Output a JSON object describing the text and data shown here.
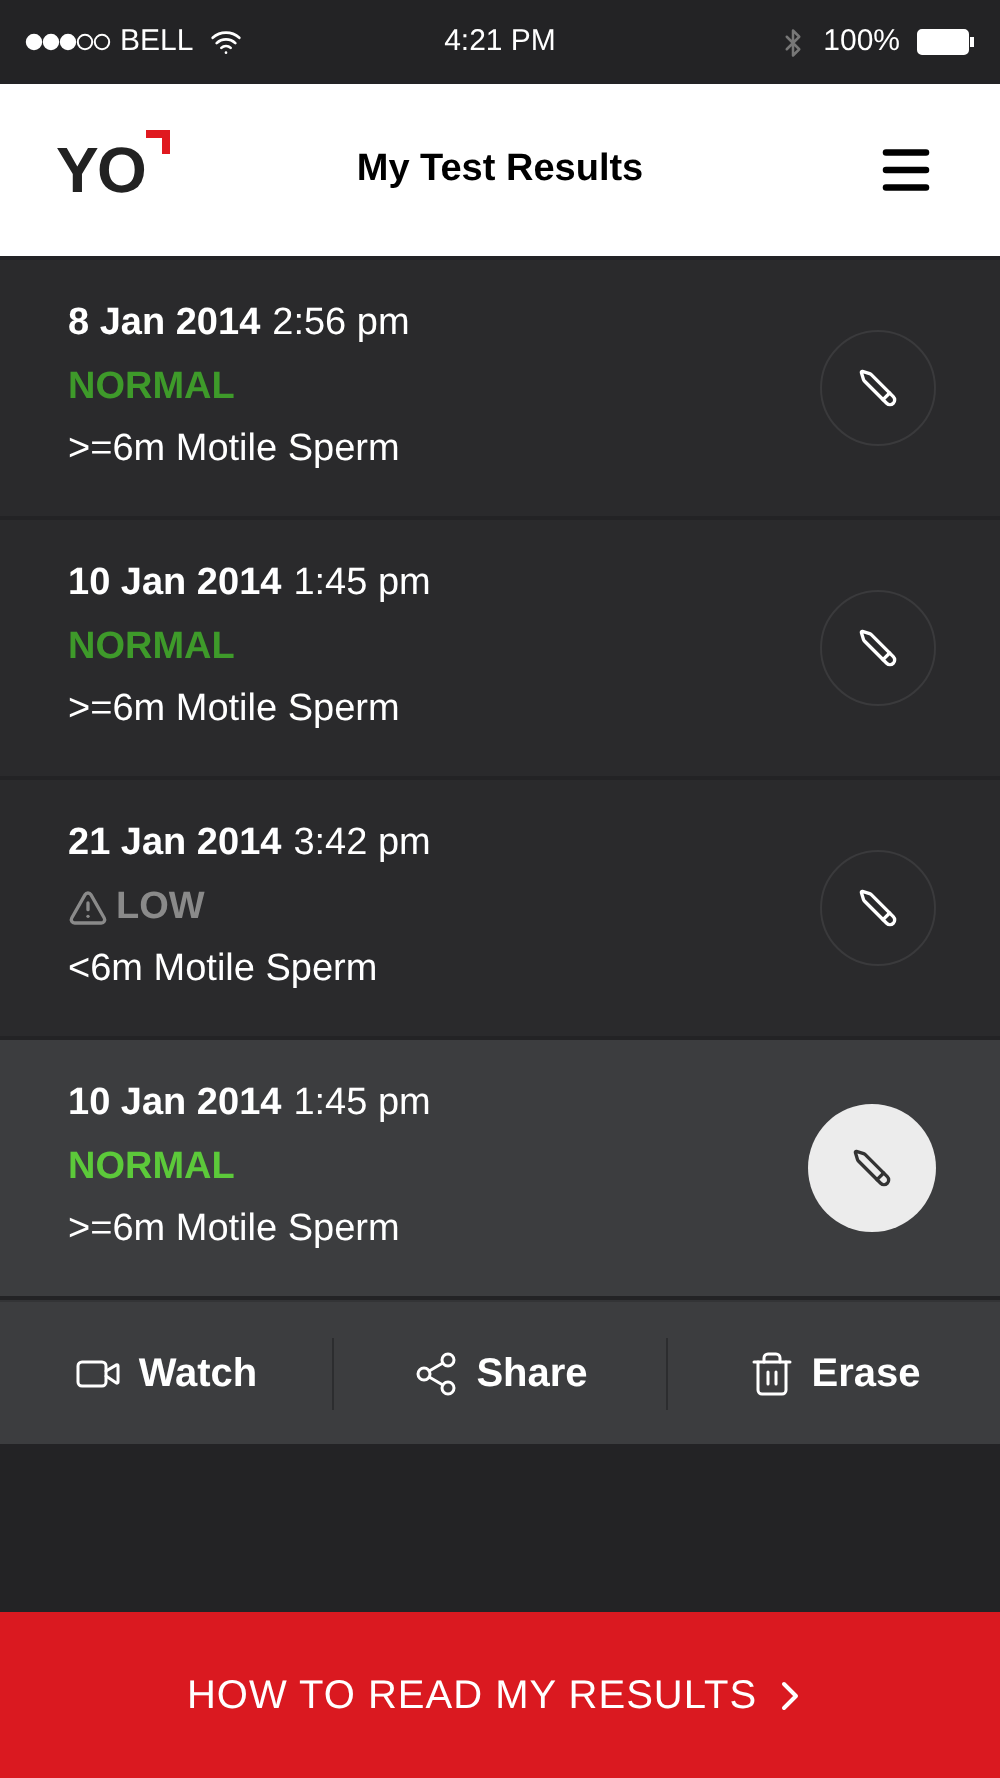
{
  "status_bar": {
    "carrier": "BELL",
    "time": "4:21 PM",
    "battery": "100%"
  },
  "header": {
    "logo": "YO",
    "title": "My Test Results"
  },
  "results": [
    {
      "date": "8 Jan 2014",
      "time": "2:56 pm",
      "status": "NORMAL",
      "kind": "normal",
      "detail": ">=6m Motile Sperm",
      "selected": false
    },
    {
      "date": "10 Jan 2014",
      "time": "1:45 pm",
      "status": "NORMAL",
      "kind": "normal",
      "detail": ">=6m Motile Sperm",
      "selected": false
    },
    {
      "date": "21 Jan 2014",
      "time": "3:42 pm",
      "status": "LOW",
      "kind": "low",
      "detail": "<6m Motile Sperm",
      "selected": false
    },
    {
      "date": "10 Jan 2014",
      "time": "1:45 pm",
      "status": "NORMAL",
      "kind": "normal",
      "detail": ">=6m Motile Sperm",
      "selected": true
    }
  ],
  "actions": [
    {
      "label": "Watch",
      "kind": "watch"
    },
    {
      "label": "Share",
      "kind": "share"
    },
    {
      "label": "Erase",
      "kind": "erase"
    }
  ],
  "footer_button": "HOW TO READ MY RESULTS"
}
